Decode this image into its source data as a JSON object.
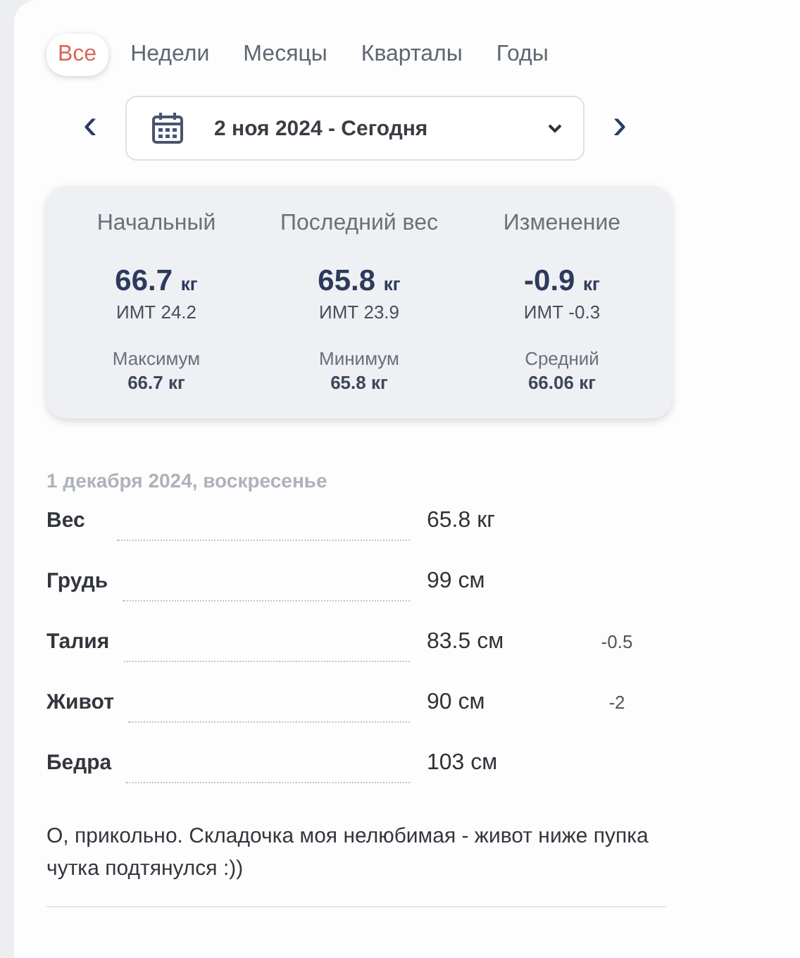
{
  "tabs": [
    {
      "label": "Все",
      "selected": true
    },
    {
      "label": "Недели",
      "selected": false
    },
    {
      "label": "Месяцы",
      "selected": false
    },
    {
      "label": "Кварталы",
      "selected": false
    },
    {
      "label": "Годы",
      "selected": false
    }
  ],
  "date_range": {
    "prev": "‹",
    "value": "2 ноя 2024 - Сегодня",
    "next": "›"
  },
  "summary": [
    {
      "title": "Начальный",
      "value": "66.7",
      "unit": "кг",
      "bmi": "ИМТ 24.2",
      "sub_label": "Максимум",
      "sub_value": "66.7 кг"
    },
    {
      "title": "Последний вес",
      "value": "65.8",
      "unit": "кг",
      "bmi": "ИМТ 23.9",
      "sub_label": "Минимум",
      "sub_value": "65.8 кг"
    },
    {
      "title": "Изменение",
      "value": "-0.9",
      "unit": "кг",
      "bmi": "ИМТ -0.3",
      "sub_label": "Средний",
      "sub_value": "66.06 кг"
    }
  ],
  "entry": {
    "date": "1 декабря 2024, воскресенье",
    "measurements": [
      {
        "label": "Вес",
        "value": "65.8 кг"
      },
      {
        "label": "Грудь",
        "value": "99 см"
      },
      {
        "label": "Талия",
        "value": "83.5 см",
        "change": "-0.5"
      },
      {
        "label": "Живот",
        "value": "90 см",
        "change": "-2"
      },
      {
        "label": "Бедра",
        "value": "103 см"
      }
    ],
    "note": "О, прикольно. Складочка моя нелюбимая - живот ниже пупка чутка подтянулся :))"
  }
}
